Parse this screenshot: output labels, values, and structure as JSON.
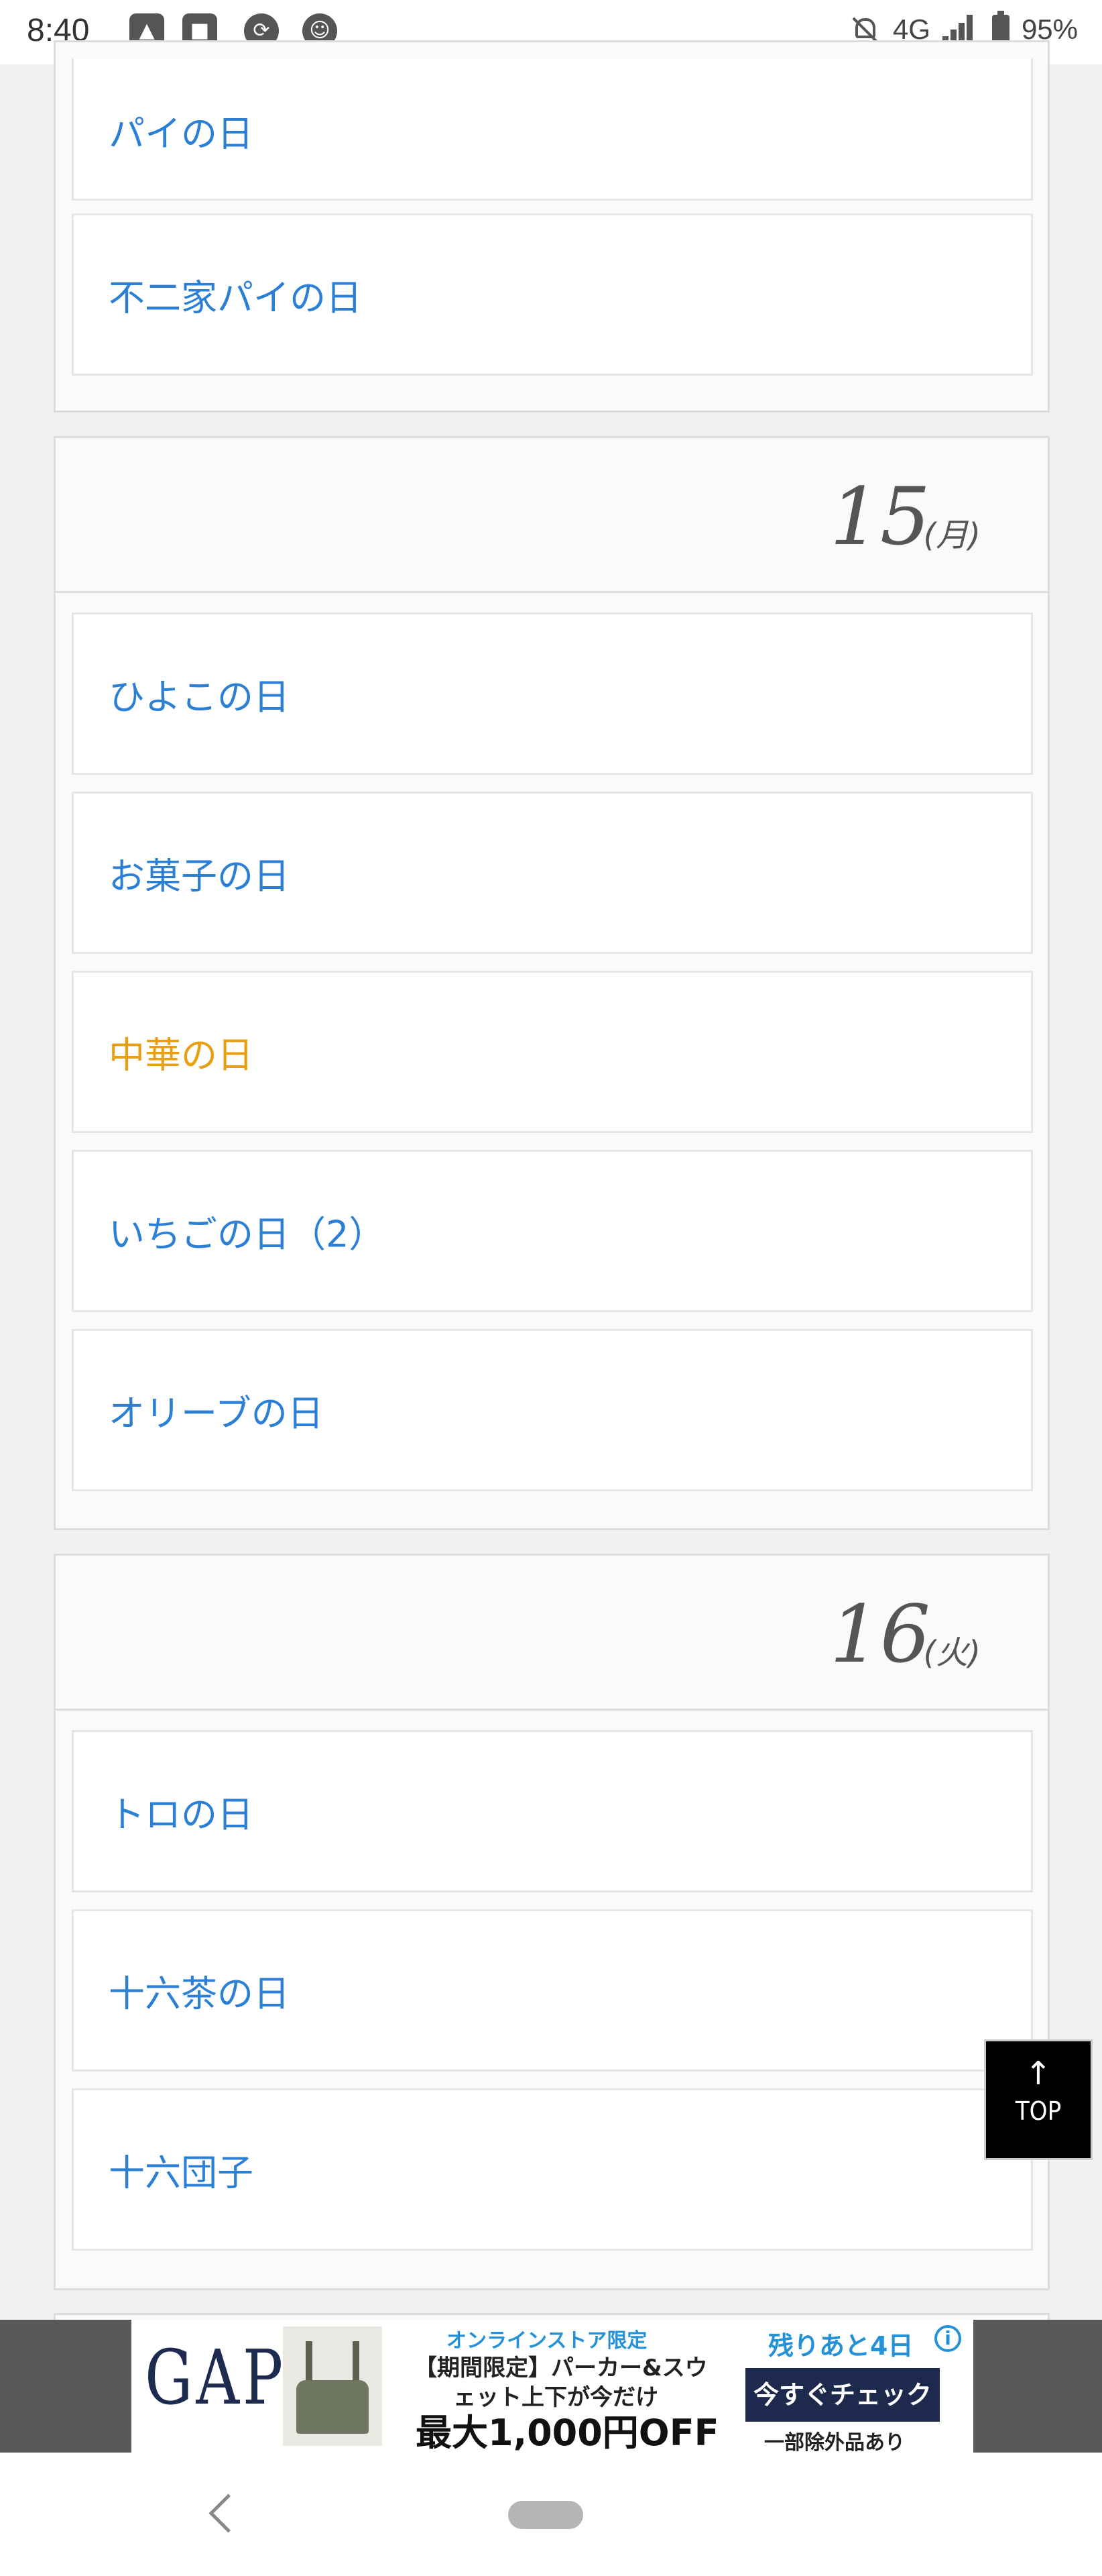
{
  "status_bar": {
    "time": "8:40",
    "network": "4G",
    "battery": "95%"
  },
  "top_partial_day": {
    "items": [
      {
        "label": "パイの日",
        "color": "#2b7fd4"
      },
      {
        "label": "不二家パイの日",
        "color": "#2b7fd4"
      }
    ]
  },
  "days": [
    {
      "day": "15",
      "dow": "(月)",
      "items": [
        {
          "label": "ひよこの日"
        },
        {
          "label": "お菓子の日"
        },
        {
          "label": "中華の日",
          "highlight": true
        },
        {
          "label": "いちごの日（2）"
        },
        {
          "label": "オリーブの日"
        }
      ]
    },
    {
      "day": "16",
      "dow": "(火)",
      "items": [
        {
          "label": "トロの日"
        },
        {
          "label": "十六茶の日"
        },
        {
          "label": "十六団子"
        }
      ]
    }
  ],
  "top_button": {
    "arrow": "↑",
    "label": "TOP"
  },
  "ad": {
    "brand": "GAP",
    "online_limited": "オンラインストア限定",
    "line1": "【期間限定】パーカー&スウ",
    "line2": "ェット上下が今だけ",
    "headline": "最大1,000円OFF",
    "remaining": "残りあと4日",
    "cta": "今すぐチェック",
    "note": "一部除外品あり",
    "info_icon": "i"
  },
  "colors": {
    "link": "#2b7fd4",
    "highlight": "#e8a012"
  }
}
